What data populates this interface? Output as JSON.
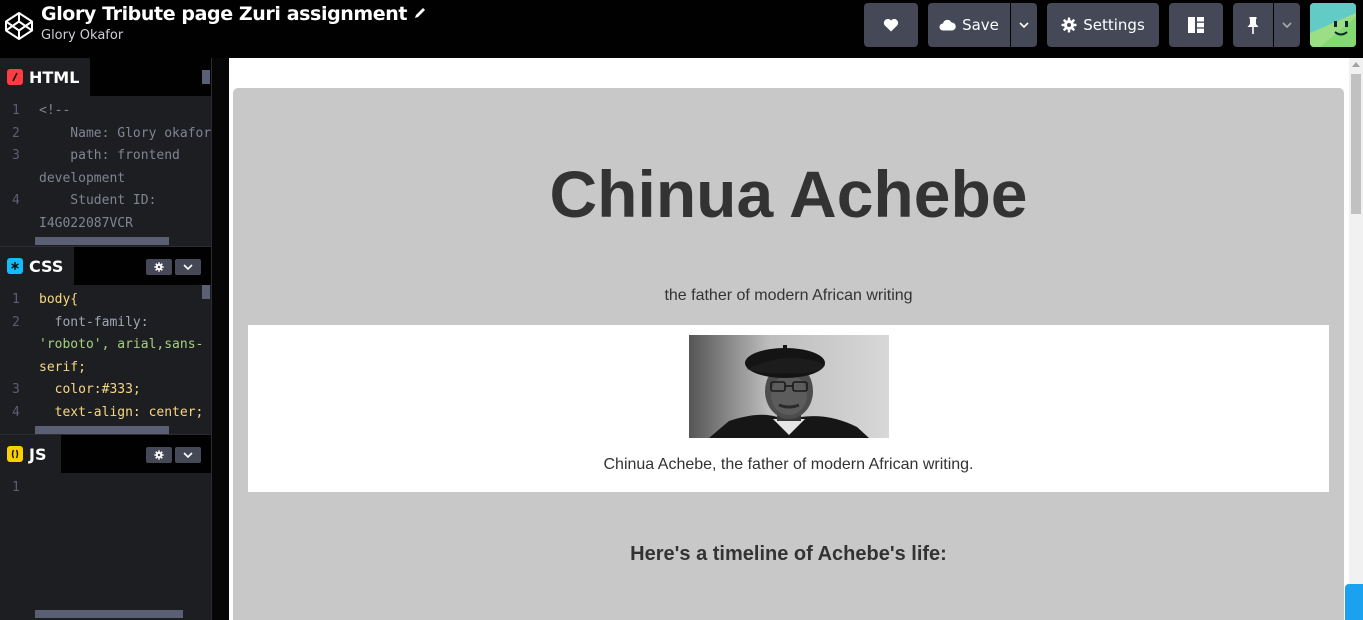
{
  "header": {
    "title": "Glory Tribute page Zuri assignment",
    "author": "Glory Okafor",
    "save_label": "Save",
    "settings_label": "Settings"
  },
  "editors": {
    "html": {
      "label": "HTML",
      "lines": [
        {
          "n": "1",
          "text": "<!--"
        },
        {
          "n": "2",
          "text": "    Name: Glory okafor"
        },
        {
          "n": "3",
          "text": "    path: frontend"
        },
        {
          "n": "",
          "text": "development"
        },
        {
          "n": "4",
          "text": "    Student ID:"
        },
        {
          "n": "",
          "text": "I4G022087VCR"
        }
      ]
    },
    "css": {
      "label": "CSS",
      "lines": [
        {
          "n": "1",
          "text": "body{"
        },
        {
          "n": "2",
          "text": "  font-family:"
        },
        {
          "n": "",
          "text": "'roboto', arial,sans-"
        },
        {
          "n": "",
          "text": "serif;"
        },
        {
          "n": "3",
          "text": "  color:#333;"
        },
        {
          "n": "4",
          "text": "  text-align: center;"
        }
      ]
    },
    "js": {
      "label": "JS",
      "lines": [
        {
          "n": "1",
          "text": ""
        }
      ]
    }
  },
  "preview": {
    "heading": "Chinua Achebe",
    "tagline": "the father of modern African writing",
    "caption": "Chinua Achebe, the father of modern African writing.",
    "timeline_heading": "Here's a timeline of Achebe's life:"
  },
  "colors": {
    "editor_bg": "#1d1e22",
    "header_bg": "#010101",
    "button_bg": "#444857",
    "html_badge": "#ff3c41",
    "css_badge": "#0ebeff",
    "js_badge": "#fcd000",
    "main_bg": "#c8c8c8",
    "text": "#333333"
  }
}
